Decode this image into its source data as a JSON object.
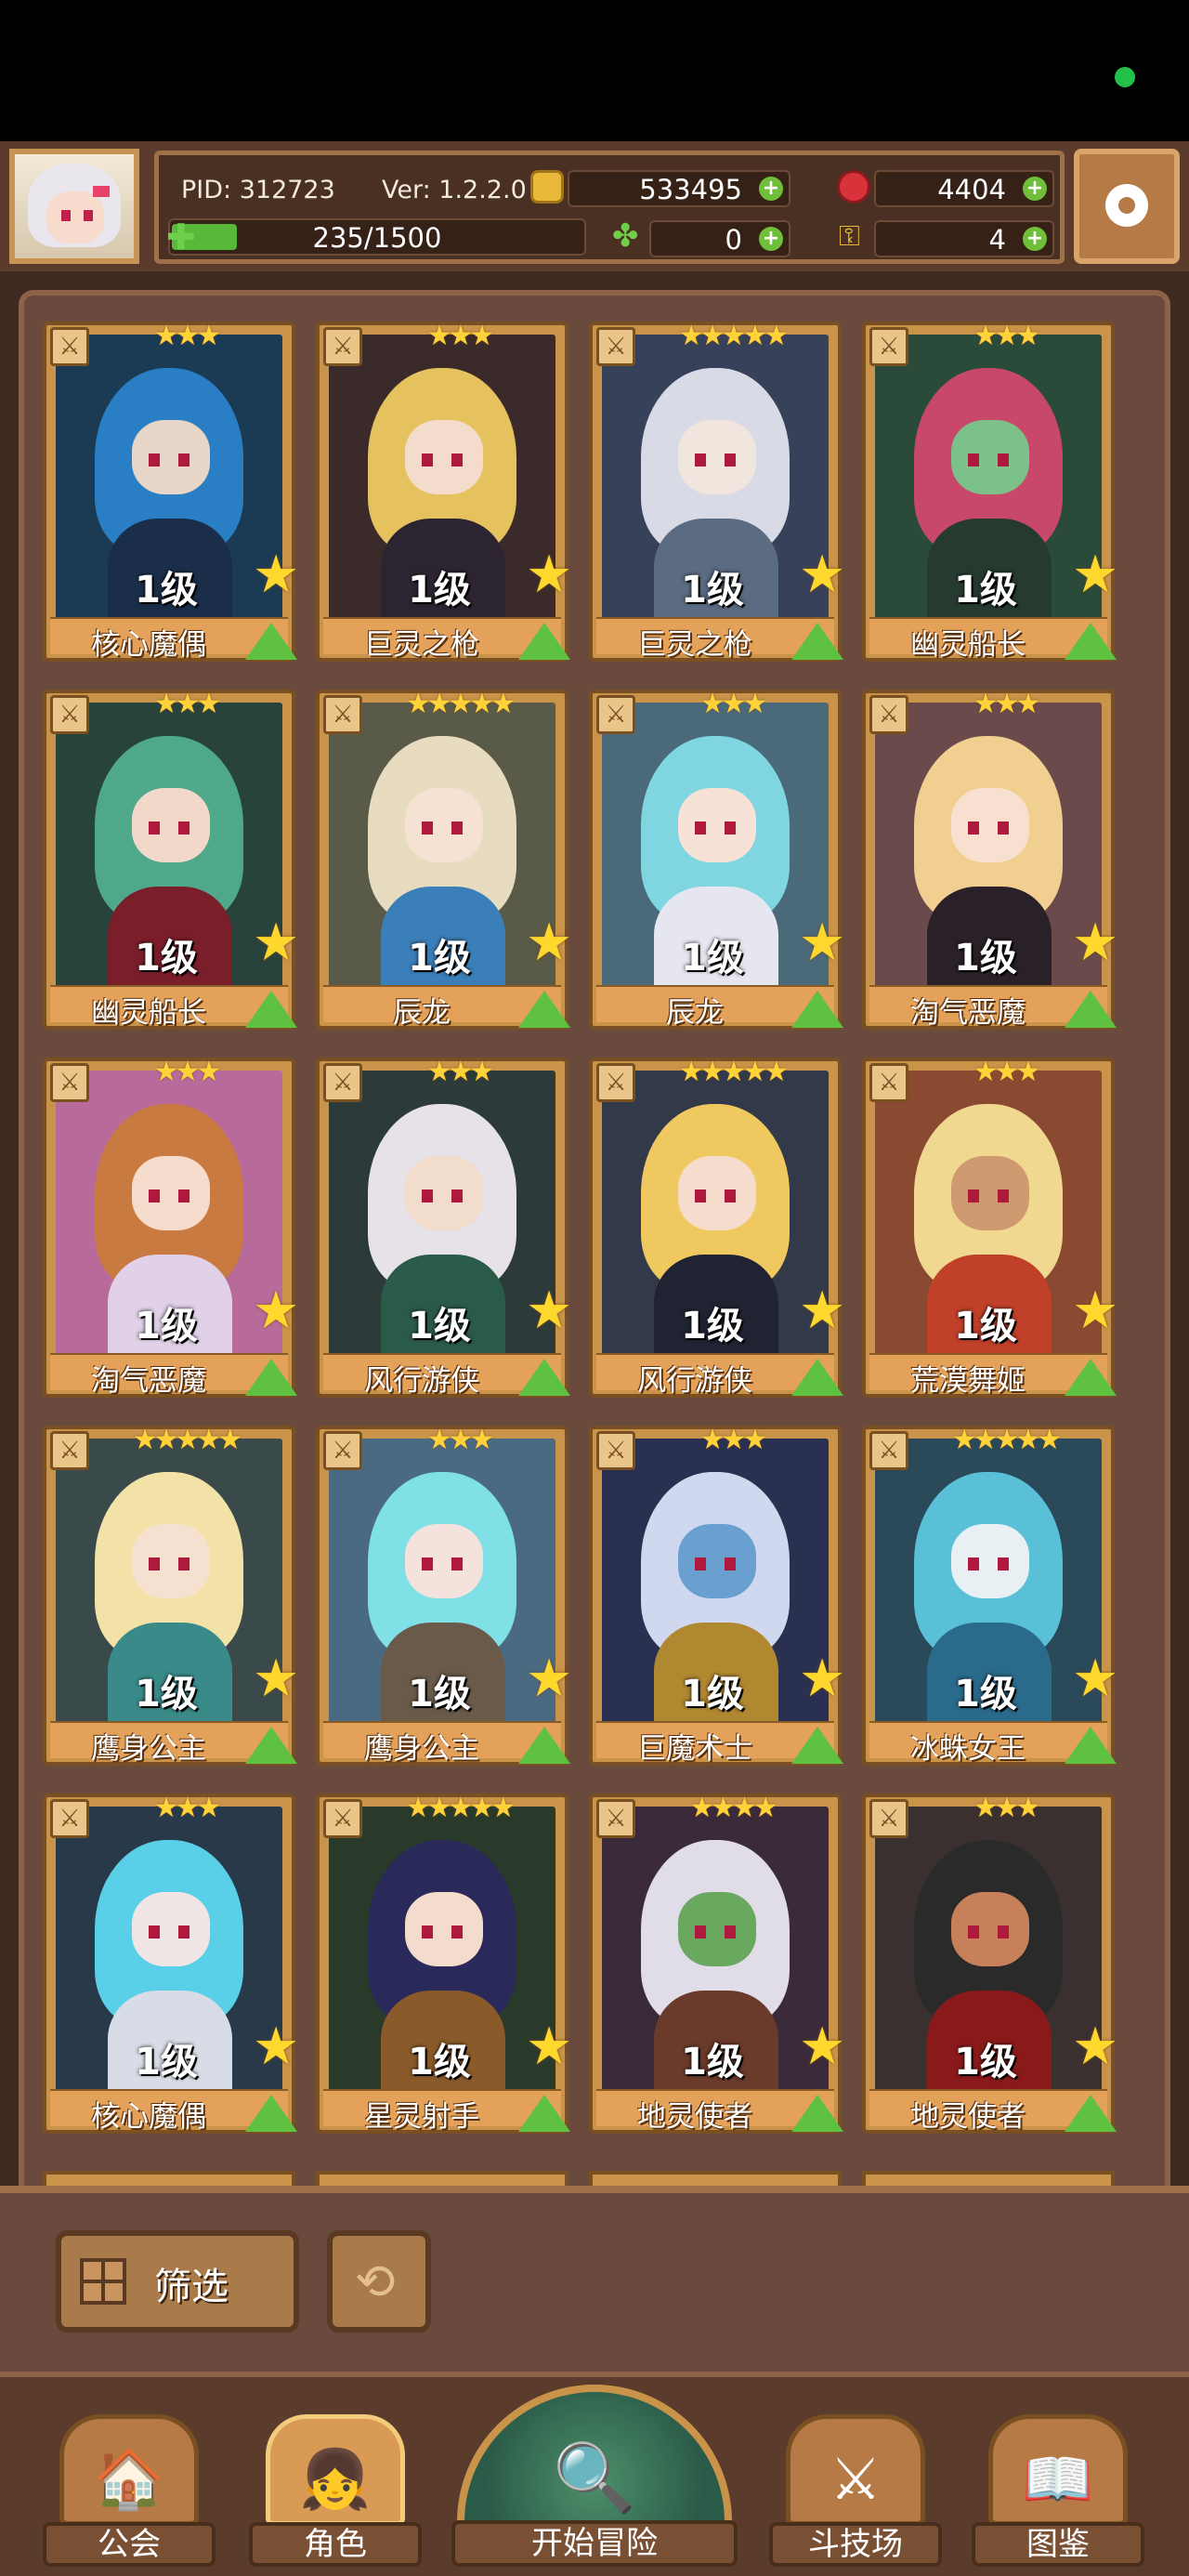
{
  "header": {
    "pid": "PID: 312723",
    "version": "Ver: 1.2.2.0",
    "gold": "533495",
    "gems": "4404",
    "stamina": "235/1500",
    "stamina_fraction": 0.157,
    "clover": "0",
    "keys": "4"
  },
  "heroes": [
    {
      "name": "核心魔偶",
      "level": "1级",
      "stars": "★★★",
      "hair": "#2a7fc4",
      "skin": "#e8d6c8",
      "outfit": "#1a2e4a",
      "bg": "#1b3b55"
    },
    {
      "name": "巨灵之枪",
      "level": "1级",
      "stars": "★★★",
      "hair": "#e6c25e",
      "skin": "#f4dccd",
      "outfit": "#2c2430",
      "bg": "#3a2a2a"
    },
    {
      "name": "巨灵之枪",
      "level": "1级",
      "stars": "★★★★★",
      "hair": "#d8dbe6",
      "skin": "#f1e6dd",
      "outfit": "#5a6b82",
      "bg": "#38415a"
    },
    {
      "name": "幽灵船长",
      "level": "1级",
      "stars": "★★★",
      "hair": "#c8486a",
      "skin": "#7cc08a",
      "outfit": "#263a30",
      "bg": "#2a4a3a"
    },
    {
      "name": "幽灵船长",
      "level": "1级",
      "stars": "★★★",
      "hair": "#4fa88a",
      "skin": "#f2d8c8",
      "outfit": "#7a1e2a",
      "bg": "#28423c"
    },
    {
      "name": "辰龙",
      "level": "1级",
      "stars": "★★★★★",
      "hair": "#e8dcc0",
      "skin": "#f6e2d2",
      "outfit": "#3b7fb8",
      "bg": "#5a5a48"
    },
    {
      "name": "辰龙",
      "level": "1级",
      "stars": "★★★",
      "hair": "#7fd6e0",
      "skin": "#f6e2d6",
      "outfit": "#e6e6f0",
      "bg": "#4a6a7a"
    },
    {
      "name": "淘气恶魔",
      "level": "1级",
      "stars": "★★★",
      "hair": "#f0cf90",
      "skin": "#f8e0d0",
      "outfit": "#2a2028",
      "bg": "#6a4a4a"
    },
    {
      "name": "淘气恶魔",
      "level": "1级",
      "stars": "★★★",
      "hair": "#c87a40",
      "skin": "#f6dccc",
      "outfit": "#e0d0e8",
      "bg": "#b86a9a"
    },
    {
      "name": "风行游侠",
      "level": "1级",
      "stars": "★★★",
      "hair": "#e6e2e8",
      "skin": "#f2dccc",
      "outfit": "#2a5a48",
      "bg": "#2c3a3a"
    },
    {
      "name": "风行游侠",
      "level": "1级",
      "stars": "★★★★★",
      "hair": "#f0c860",
      "skin": "#f6dccc",
      "outfit": "#202432",
      "bg": "#323a4a"
    },
    {
      "name": "荒漠舞姬",
      "level": "1级",
      "stars": "★★★",
      "hair": "#f0d890",
      "skin": "#d09a70",
      "outfit": "#c0402a",
      "bg": "#8a4a32"
    },
    {
      "name": "鹰身公主",
      "level": "1级",
      "stars": "★★★★★",
      "hair": "#f2e2a8",
      "skin": "#f6e0d0",
      "outfit": "#3a8a8a",
      "bg": "#3a4a4a"
    },
    {
      "name": "鹰身公主",
      "level": "1级",
      "stars": "★★★",
      "hair": "#7fe0e6",
      "skin": "#f4e2dc",
      "outfit": "#6a5a4a",
      "bg": "#4a6a82"
    },
    {
      "name": "巨魔术士",
      "level": "1级",
      "stars": "★★★",
      "hair": "#d0d8f0",
      "skin": "#6aa0d0",
      "outfit": "#b08830",
      "bg": "#2a3050"
    },
    {
      "name": "冰蛛女王",
      "level": "1级",
      "stars": "★★★★★",
      "hair": "#5ac0d8",
      "skin": "#e8f0f4",
      "outfit": "#2a6a8a",
      "bg": "#2a4a5a"
    },
    {
      "name": "核心魔偶",
      "level": "1级",
      "stars": "★★★",
      "hair": "#5ad0e8",
      "skin": "#f0e6e6",
      "outfit": "#d8dce6",
      "bg": "#283a4a"
    },
    {
      "name": "星灵射手",
      "level": "1级",
      "stars": "★★★★★",
      "hair": "#2a2a5a",
      "skin": "#f4dccc",
      "outfit": "#8a5a2a",
      "bg": "#2a3a2a"
    },
    {
      "name": "地灵使者",
      "level": "1级",
      "stars": "★★★★",
      "hair": "#e0dce8",
      "skin": "#6aa860",
      "outfit": "#6a3a2a",
      "bg": "#3a2a3a"
    },
    {
      "name": "地灵使者",
      "level": "1级",
      "stars": "★★★",
      "hair": "#2a2a2a",
      "skin": "#c8805a",
      "outfit": "#8a1a1a",
      "bg": "#3a3030"
    }
  ],
  "filter": {
    "label": "筛选"
  },
  "nav": {
    "guild": "公会",
    "character": "角色",
    "adventure": "开始冒险",
    "arena": "斗技场",
    "codex": "图鉴"
  },
  "icons": {
    "settings": "gear-icon",
    "filter": "grid-icon",
    "refresh": "refresh-icon",
    "hero_type": "sword-icon",
    "level_up": "up-arrow-icon"
  }
}
